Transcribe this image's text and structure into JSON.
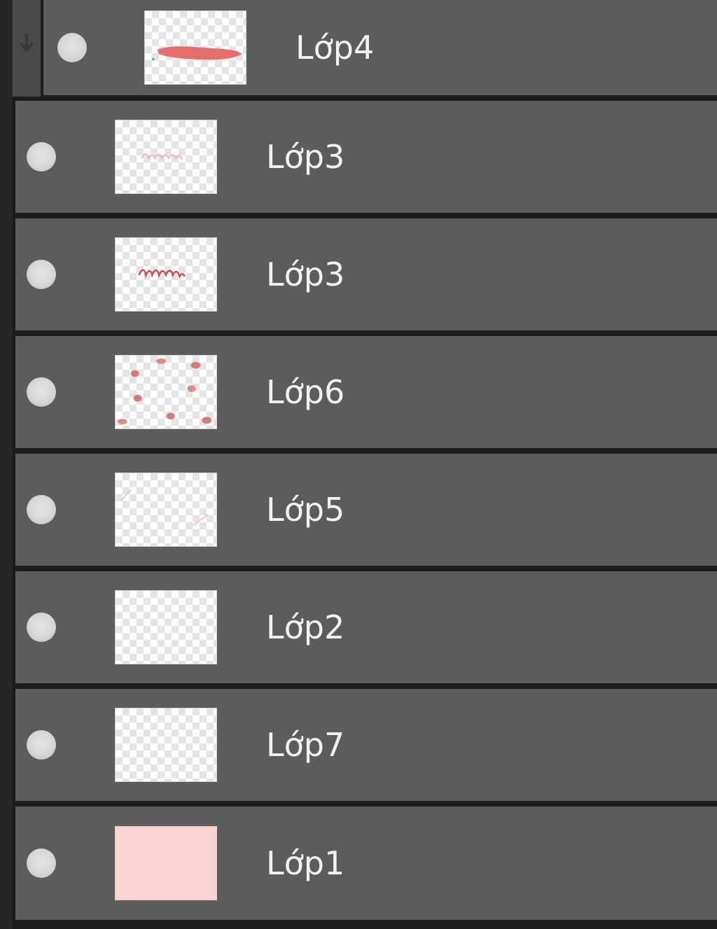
{
  "panel": {
    "name": "layers-panel",
    "layers": [
      {
        "name": "Lớp4",
        "thumbnail": "red-stroke",
        "clipped": true,
        "visible": true
      },
      {
        "name": "Lớp3",
        "thumbnail": "faint-text",
        "clipped": false,
        "visible": true
      },
      {
        "name": "Lớp3",
        "thumbnail": "text",
        "clipped": false,
        "visible": true
      },
      {
        "name": "Lớp6",
        "thumbnail": "scattered-dots",
        "clipped": false,
        "visible": true
      },
      {
        "name": "Lớp5",
        "thumbnail": "faint-marks",
        "clipped": false,
        "visible": true
      },
      {
        "name": "Lớp2",
        "thumbnail": "empty",
        "clipped": false,
        "visible": true
      },
      {
        "name": "Lớp7",
        "thumbnail": "empty",
        "clipped": false,
        "visible": true
      },
      {
        "name": "Lớp1",
        "thumbnail": "solid-fill",
        "clipped": false,
        "visible": true,
        "fill_color": "#fcd3d3"
      }
    ],
    "colors": {
      "row_bg": "#5c5c5c",
      "separator": "#1c1c1c",
      "text": "#f2f2f2",
      "accent_red": "#e0615f"
    },
    "icons": {
      "visibility": "eye-dot-icon",
      "clip": "clipping-arrow-icon"
    }
  }
}
